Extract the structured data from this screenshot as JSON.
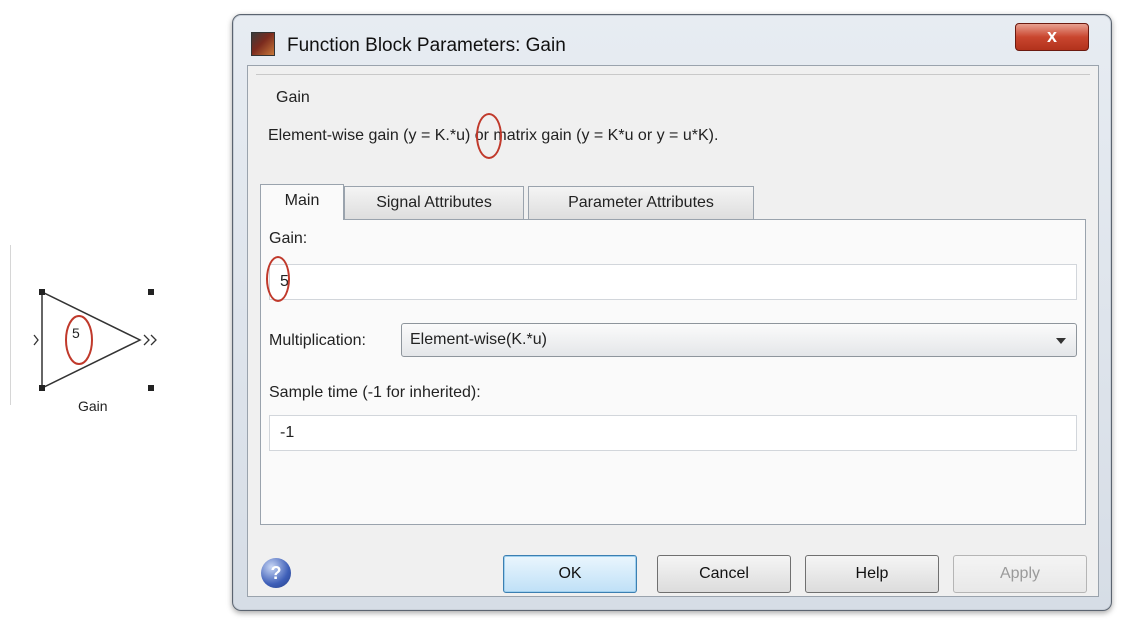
{
  "block": {
    "value": "5",
    "name": "Gain"
  },
  "dialog": {
    "title": "Function Block Parameters: Gain",
    "close_label": "x",
    "description": {
      "group_title": "Gain",
      "text": "Element-wise gain (y = K.*u) or matrix gain (y = K*u or y = u*K)."
    },
    "tabs": [
      {
        "label": "Main",
        "active": true
      },
      {
        "label": "Signal Attributes",
        "active": false
      },
      {
        "label": "Parameter Attributes",
        "active": false
      }
    ],
    "main": {
      "gain_label": "Gain:",
      "gain_value": "5",
      "multiplication_label": "Multiplication:",
      "multiplication_value": "Element-wise(K.*u)",
      "sample_time_label": "Sample time (-1 for inherited):",
      "sample_time_value": "-1"
    },
    "buttons": {
      "help_icon": "?",
      "ok": "OK",
      "cancel": "Cancel",
      "help": "Help",
      "apply": "Apply"
    }
  },
  "annotation_color": "#c0392b"
}
